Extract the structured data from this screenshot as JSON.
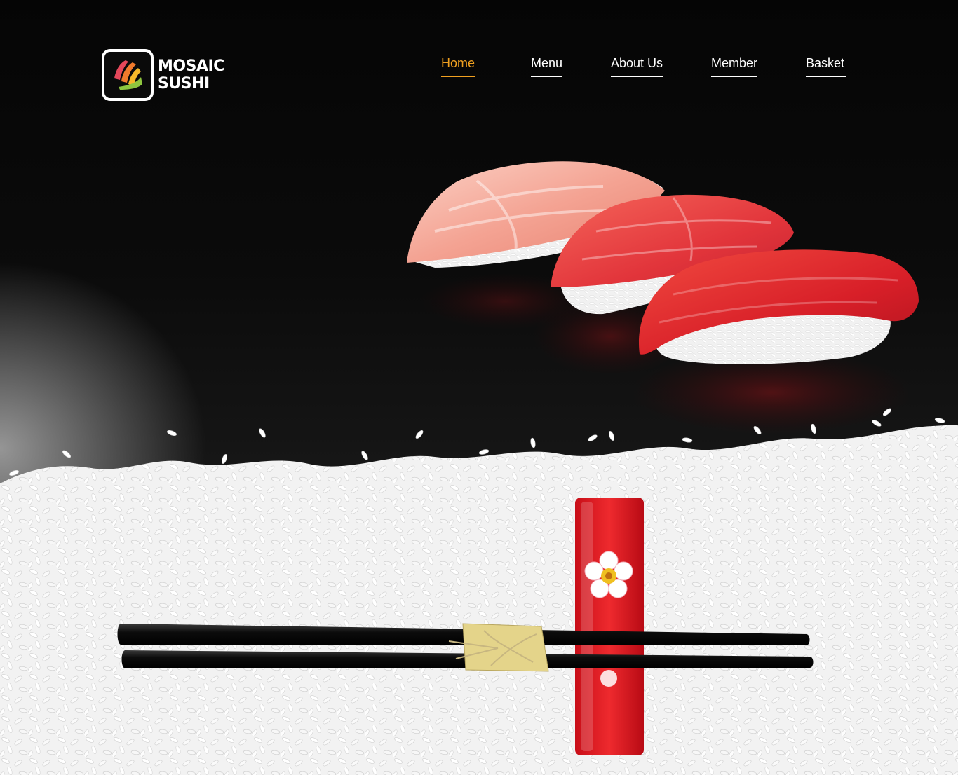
{
  "brand": {
    "line1": "MOSAIC",
    "line2": "SUSHI",
    "logo_icon": "mosaic-sushi-logo-icon"
  },
  "nav": {
    "items": [
      {
        "label": "Home",
        "active": true
      },
      {
        "label": "Menu",
        "active": false
      },
      {
        "label": "About Us",
        "active": false
      },
      {
        "label": "Member",
        "active": false
      },
      {
        "label": "Basket",
        "active": false
      }
    ]
  },
  "colors": {
    "accent": "#f0a020",
    "background": "#0b0b0b",
    "nav_text": "#ffffff"
  },
  "hero": {
    "image": "sushi-nigiri-chopsticks-rice-photo"
  }
}
